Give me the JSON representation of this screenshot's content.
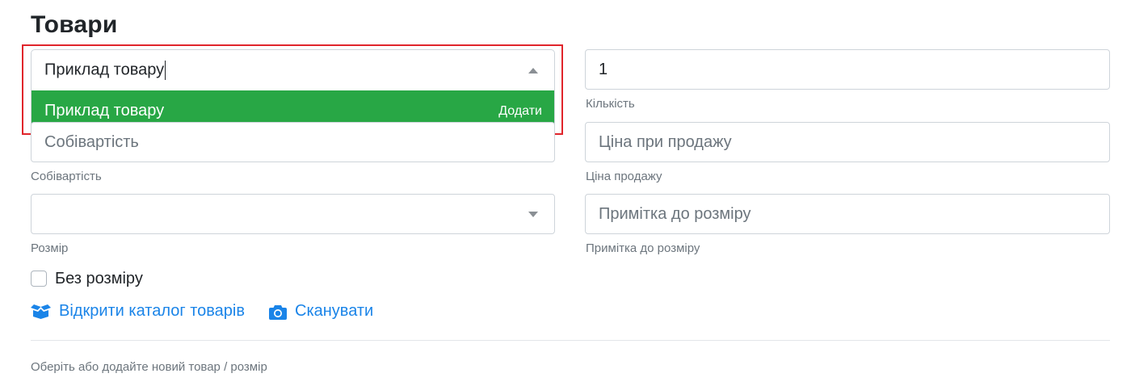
{
  "section": {
    "title": "Товари"
  },
  "product_select": {
    "value": "Приклад товару",
    "option": {
      "label": "Приклад товару",
      "add_label": "Додати"
    }
  },
  "quantity": {
    "value": "1",
    "label": "Кількість"
  },
  "cost": {
    "placeholder": "Собівартість",
    "label": "Собівартість"
  },
  "sale_price": {
    "placeholder": "Ціна при продажу",
    "label": "Ціна продажу"
  },
  "size": {
    "value": "",
    "label": "Розмір"
  },
  "size_note": {
    "placeholder": "Примітка до розміру",
    "label": "Примітка до розміру"
  },
  "no_size": {
    "label": "Без розміру",
    "checked": false
  },
  "actions": {
    "catalog_label": "Відкрити каталог товарів",
    "catalog_icon": "box-open-icon",
    "scan_label": "Сканувати",
    "scan_icon": "camera-icon"
  },
  "hint": "Оберіть або додайте новий товар / розмір",
  "colors": {
    "accent": "#1a84e8",
    "option_bg": "#28a745",
    "highlight": "#e0252b"
  }
}
